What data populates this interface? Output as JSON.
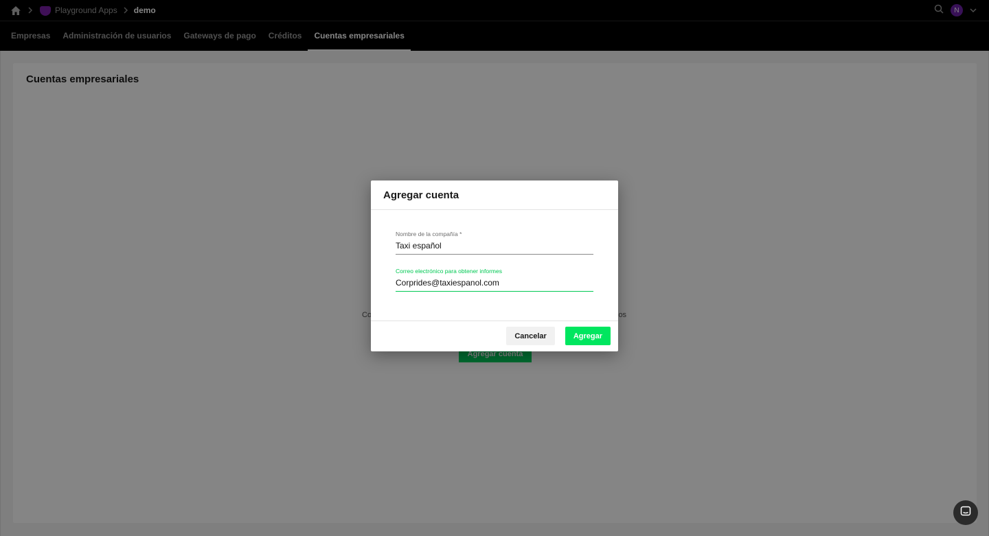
{
  "breadcrumb": {
    "home_icon": "home-icon",
    "app_name": "Playground Apps",
    "current": "demo"
  },
  "topbar": {
    "search_icon": "search-icon",
    "user_initial": "N",
    "chevron_icon": "chevron-down-icon"
  },
  "nav": {
    "tabs": [
      {
        "label": "Empresas",
        "active": false
      },
      {
        "label": "Administración de usuarios",
        "active": false
      },
      {
        "label": "Gateways de pago",
        "active": false
      },
      {
        "label": "Créditos",
        "active": false
      },
      {
        "label": "Cuentas empresariales",
        "active": true
      }
    ]
  },
  "page": {
    "title": "Cuentas empresariales",
    "empty_text_left": "Co",
    "empty_text_right": "los",
    "empty_button": "Agregar cuenta"
  },
  "modal": {
    "title": "Agregar cuenta",
    "company_label": "Nombre de la compañía *",
    "company_value": "Taxi español",
    "email_label": "Correo electrónico para obtener informes",
    "email_value": "Corprides@taxiespanol.com",
    "cancel_label": "Cancelar",
    "add_label": "Agregar"
  },
  "colors": {
    "accent_green": "#00e65f",
    "focus_green": "#00c853",
    "avatar_purple": "#6b21a8"
  }
}
